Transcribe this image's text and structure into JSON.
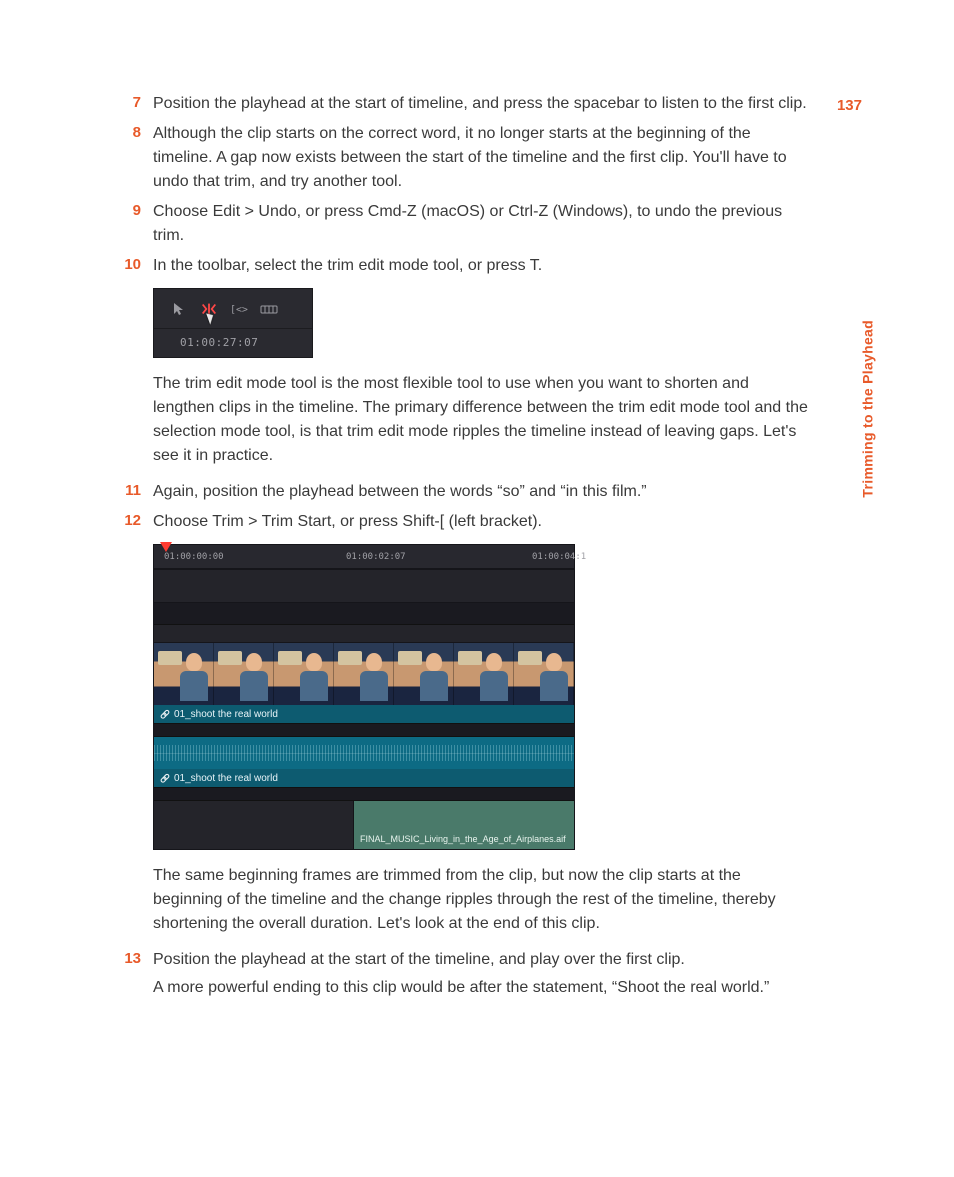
{
  "page_number": "137",
  "section_title": "Trimming to the Playhead",
  "steps": {
    "s7": "Position the playhead at the start of timeline, and press the spacebar to listen to the first clip.",
    "s8": "Although the clip starts on the correct word, it no longer starts at the beginning of the timeline. A gap now exists between the start of the timeline and the first clip. You'll have to undo that trim, and try another tool.",
    "s9": "Choose Edit > Undo, or press Cmd-Z (macOS) or Ctrl-Z (Windows), to undo the previous trim.",
    "s10": "In the toolbar, select the trim edit mode tool, or press T.",
    "s10_explain": "The trim edit mode tool is the most flexible tool to use when you want to shorten and lengthen clips in the timeline. The primary difference between the trim edit mode tool and the selection mode tool, is that trim edit mode ripples the timeline instead of leaving gaps. Let's see it in practice.",
    "s11": "Again, position the playhead between the words “so” and “in this film.”",
    "s12": "Choose Trim > Trim Start, or press Shift-[ (left bracket).",
    "s12_explain": "The same beginning frames are trimmed from the clip, but now the clip starts at the beginning of the timeline and the change ripples through the rest of the timeline, thereby shortening the overall duration. Let's look at the end of this clip.",
    "s13": "Position the playhead at the start of the timeline, and play over the first clip.",
    "s13_extra": "A more powerful ending to this clip would be after the statement, “Shoot the real world.”"
  },
  "toolbar": {
    "timecode": "01:00:27:07"
  },
  "timeline": {
    "t1": "01:00:00:00",
    "t2": "01:00:02:07",
    "t3": "01:00:04:1",
    "clip_name": "01_shoot the real world",
    "music_name": "FINAL_MUSIC_Living_in_the_Age_of_Airplanes.aif"
  },
  "nums": {
    "n7": "7",
    "n8": "8",
    "n9": "9",
    "n10": "10",
    "n11": "11",
    "n12": "12",
    "n13": "13"
  }
}
